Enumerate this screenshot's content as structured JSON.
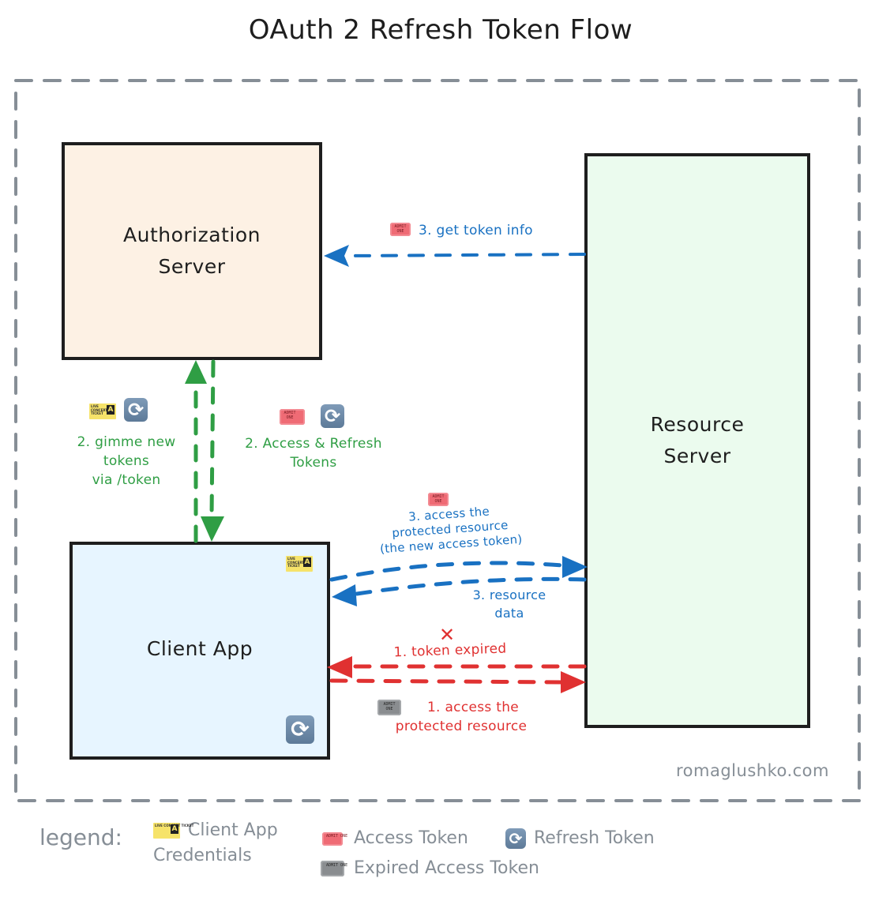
{
  "title": "OAuth 2 Refresh Token Flow",
  "colors": {
    "auth_server_fill": "#fdf1e4",
    "resource_server_fill": "#ebfbee",
    "client_app_fill": "#e7f5ff",
    "green": "#2f9e44",
    "blue": "#1971c2",
    "red": "#e03131",
    "grey": "#868e96"
  },
  "nodes": {
    "auth_server": {
      "line1": "Authorization",
      "line2": "Server"
    },
    "resource_server": {
      "line1": "Resource",
      "line2": "Server"
    },
    "client_app": {
      "label": "Client App",
      "icons": [
        "client-credentials-icon",
        "refresh-token-icon"
      ]
    }
  },
  "edges": {
    "get_token_info": {
      "label": "3. get token info",
      "icon": "access-token-icon"
    },
    "gimme_tokens": {
      "line1": "2. gimme new",
      "line2": "tokens",
      "line3": "via /token",
      "icons": [
        "client-credentials-icon",
        "refresh-token-icon"
      ]
    },
    "access_refresh": {
      "line1": "2. Access & Refresh",
      "line2": "Tokens",
      "icons": [
        "access-token-icon",
        "refresh-token-icon"
      ]
    },
    "access_new": {
      "line1": "3. access the",
      "line2": "protected resource",
      "line3": "(the new access token)",
      "icon": "access-token-icon"
    },
    "resource_data": {
      "line1": "3. resource",
      "line2": "data"
    },
    "token_expired": {
      "label": "1. token expired",
      "mark": "✕"
    },
    "access_expired": {
      "line1": "1. access the",
      "line2": "protected resource",
      "icon": "expired-access-token-icon"
    }
  },
  "watermark": "romaglushko.com",
  "legend": {
    "title": "legend:",
    "items": [
      {
        "icon": "client-credentials-icon",
        "line1": "Client App",
        "line2": "Credentials"
      },
      {
        "icon": "access-token-icon",
        "label": "Access Token"
      },
      {
        "icon": "refresh-token-icon",
        "label": "Refresh Token"
      },
      {
        "icon": "expired-access-token-icon",
        "label": "Expired Access Token"
      }
    ]
  },
  "glyphs": {
    "refresh": "⟳"
  }
}
